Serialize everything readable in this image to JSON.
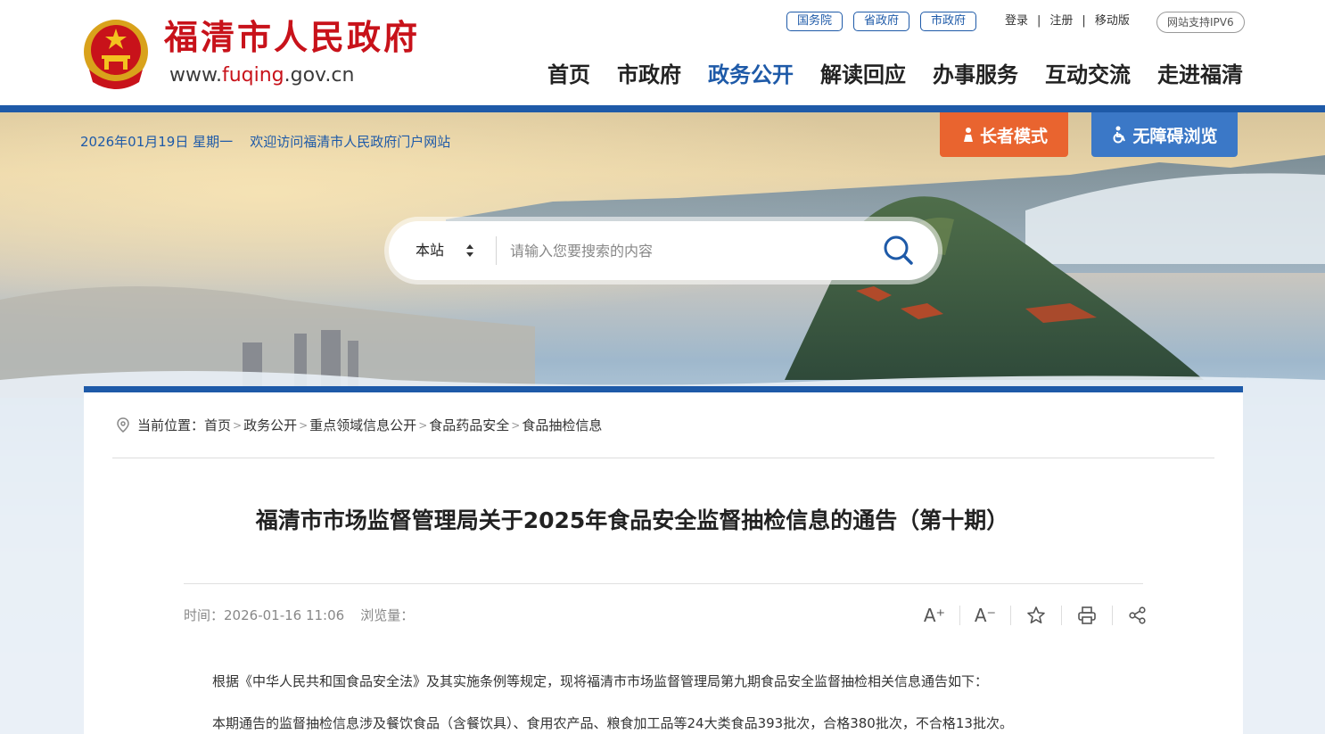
{
  "header": {
    "site_name": "福清市人民政府",
    "url_prefix": "www.",
    "url_highlight": "fuqing",
    "url_suffix": ".gov.cn",
    "gov_links": [
      "国务院",
      "省政府",
      "市政府"
    ],
    "user_links": [
      "登录",
      "注册",
      "移动版"
    ],
    "ipv6_badge": "网站支持IPV6",
    "nav": [
      "首页",
      "市政府",
      "政务公开",
      "解读回应",
      "办事服务",
      "互动交流",
      "走进福清"
    ],
    "active_nav": "政务公开"
  },
  "banner": {
    "date_text": "2026年01月19日 星期一",
    "welcome_text": "欢迎访问福清市人民政府门户网站",
    "elder_mode": "长者模式",
    "accessibility": "无障碍浏览",
    "search_scope": "本站",
    "search_placeholder": "请输入您要搜索的内容"
  },
  "breadcrumb": {
    "label": "当前位置：",
    "items": [
      "首页",
      "政务公开",
      "重点领域信息公开",
      "食品药品安全",
      "食品抽检信息"
    ]
  },
  "article": {
    "title": "福清市市场监督管理局关于2025年食品安全监督抽检信息的通告（第十期）",
    "time_label": "时间：",
    "time_value": "2026-01-16 11:06",
    "views_label": "浏览量：",
    "tools": {
      "increase_font": "A⁺",
      "decrease_font": "A⁻"
    },
    "paragraphs": [
      "根据《中华人民共和国食品安全法》及其实施条例等规定，现将福清市市场监督管理局第九期食品安全监督抽检相关信息通告如下：",
      "本期通告的监督抽检信息涉及餐饮食品（含餐饮具）、食用农产品、粮食加工品等24大类食品393批次，合格380批次，不合格13批次。"
    ]
  },
  "colors": {
    "brand_red": "#c8121a",
    "brand_blue": "#1e5aa8",
    "elder_orange": "#e9642f",
    "access_blue": "#3b78c7"
  }
}
